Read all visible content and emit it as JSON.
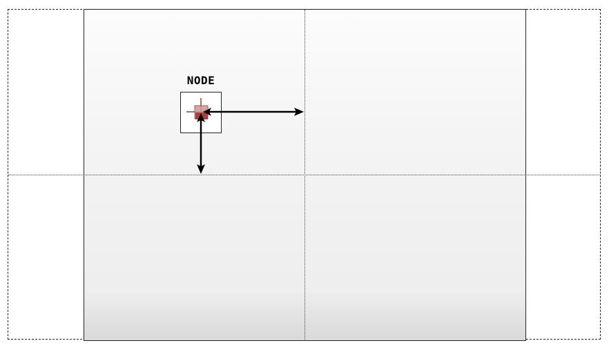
{
  "node": {
    "label": "NODE"
  },
  "colors": {
    "pivot": "#a23a3a",
    "arrow": "#000000",
    "frame": "#222222"
  },
  "icons": {
    "pivot": "pivot-crosshair-icon",
    "horizontal_arrow": "double-arrow-horizontal-icon",
    "vertical_arrow": "double-arrow-vertical-icon"
  }
}
